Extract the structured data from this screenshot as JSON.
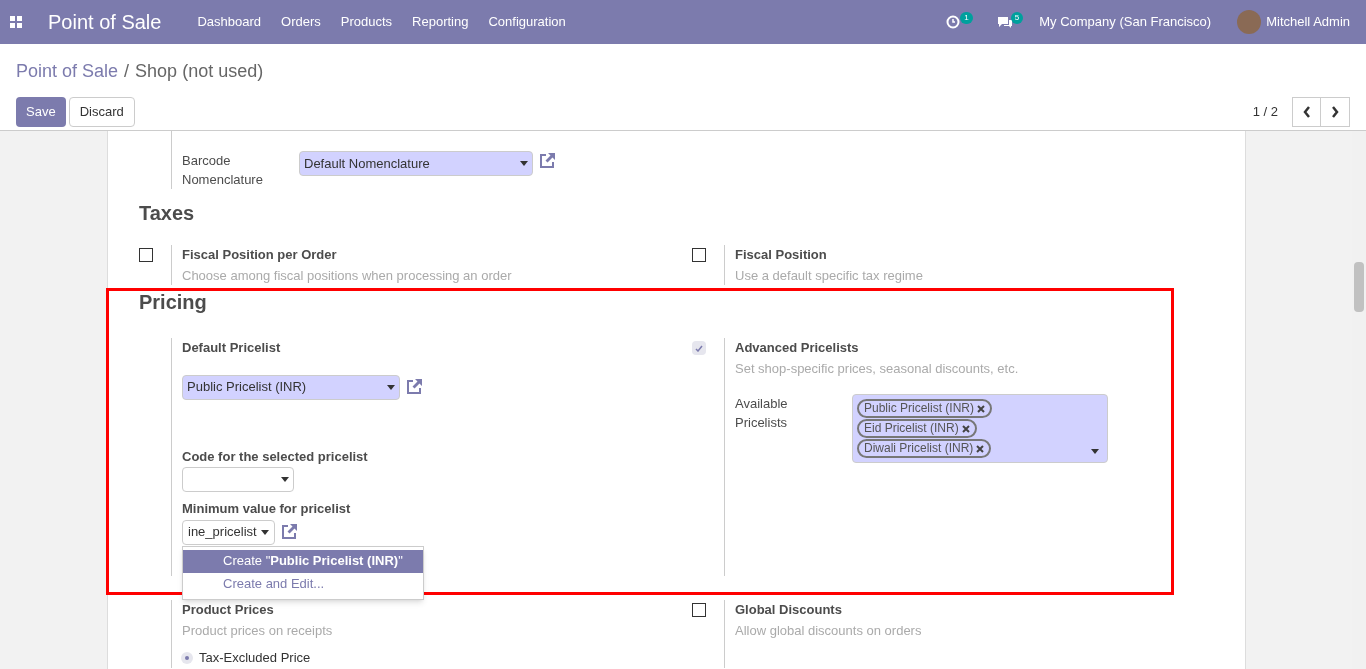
{
  "navbar": {
    "app_name": "Point of Sale",
    "menu": [
      "Dashboard",
      "Orders",
      "Products",
      "Reporting",
      "Configuration"
    ],
    "activity_count": "1",
    "message_count": "5",
    "company": "My Company (San Francisco)",
    "user": "Mitchell Admin"
  },
  "breadcrumb": {
    "parent": "Point of Sale",
    "separator": "/",
    "current": "Shop (not used)"
  },
  "buttons": {
    "save": "Save",
    "discard": "Discard"
  },
  "pager": "1 / 2",
  "barcode": {
    "label": "Barcode Nomenclature",
    "value": "Default Nomenclature"
  },
  "taxes": {
    "title": "Taxes",
    "settings": [
      {
        "title": "Fiscal Position per Order",
        "description": "Choose among fiscal positions when processing an order",
        "checked": false
      },
      {
        "title": "Fiscal Position",
        "description": "Use a default specific tax regime",
        "checked": false
      }
    ]
  },
  "pricing": {
    "title": "Pricing",
    "default_pricelist": {
      "label": "Default Pricelist",
      "value": "Public Pricelist (INR)"
    },
    "code": {
      "label": "Code for the selected pricelist"
    },
    "minimum": {
      "label": "Minimum value for pricelist",
      "value": "ine_pricelist"
    },
    "dropdown": [
      {
        "label": "Create \"**Public Pricelist (INR)**\"",
        "selected": true
      },
      {
        "label": "Create and Edit...",
        "selected": false
      }
    ],
    "advanced": {
      "title": "Advanced Pricelists",
      "description": "Set shop-specific prices, seasonal discounts, etc.",
      "checked": true,
      "available_label": "Available Pricelists",
      "tags": [
        "Public Pricelist (INR)",
        "Eid Pricelist (INR)",
        "Diwali Pricelist (INR)"
      ]
    }
  },
  "lower": {
    "left": {
      "title": "Product Prices",
      "description": "Product prices on receipts",
      "options": [
        {
          "label": "Tax-Excluded Price",
          "selected": true
        }
      ]
    },
    "right": {
      "title": "Global Discounts",
      "description": "Allow global discounts on orders",
      "checked": false
    }
  }
}
